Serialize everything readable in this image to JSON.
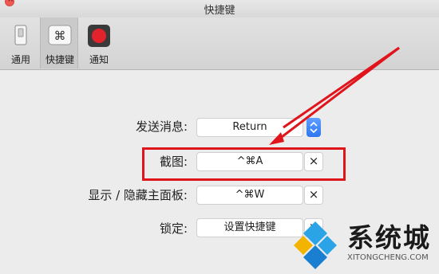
{
  "window": {
    "title": "快捷键"
  },
  "toolbar": {
    "items": [
      {
        "label": "通用",
        "icon": "switch-icon"
      },
      {
        "label": "快捷键",
        "icon": "command-key-icon",
        "active": true
      },
      {
        "label": "通知",
        "icon": "record-icon"
      }
    ],
    "command_glyph": "⌘"
  },
  "settings": {
    "send_message": {
      "label": "发送消息:",
      "value": "Return"
    },
    "screenshot": {
      "label": "截图:",
      "value": "^⌘A",
      "clear": "×"
    },
    "toggle_panel": {
      "label": "显示 / 隐藏主面板:",
      "value": "^⌘W",
      "clear": "×"
    },
    "lock": {
      "label": "锁定:",
      "value": "设置快捷键",
      "clear": "×"
    }
  },
  "watermark": {
    "title": "系统城",
    "subtitle": "XITONGCHENG.COM"
  },
  "colors": {
    "highlight": "#e0141b",
    "accent": "#2f76f0",
    "close": "#ee5a52"
  }
}
